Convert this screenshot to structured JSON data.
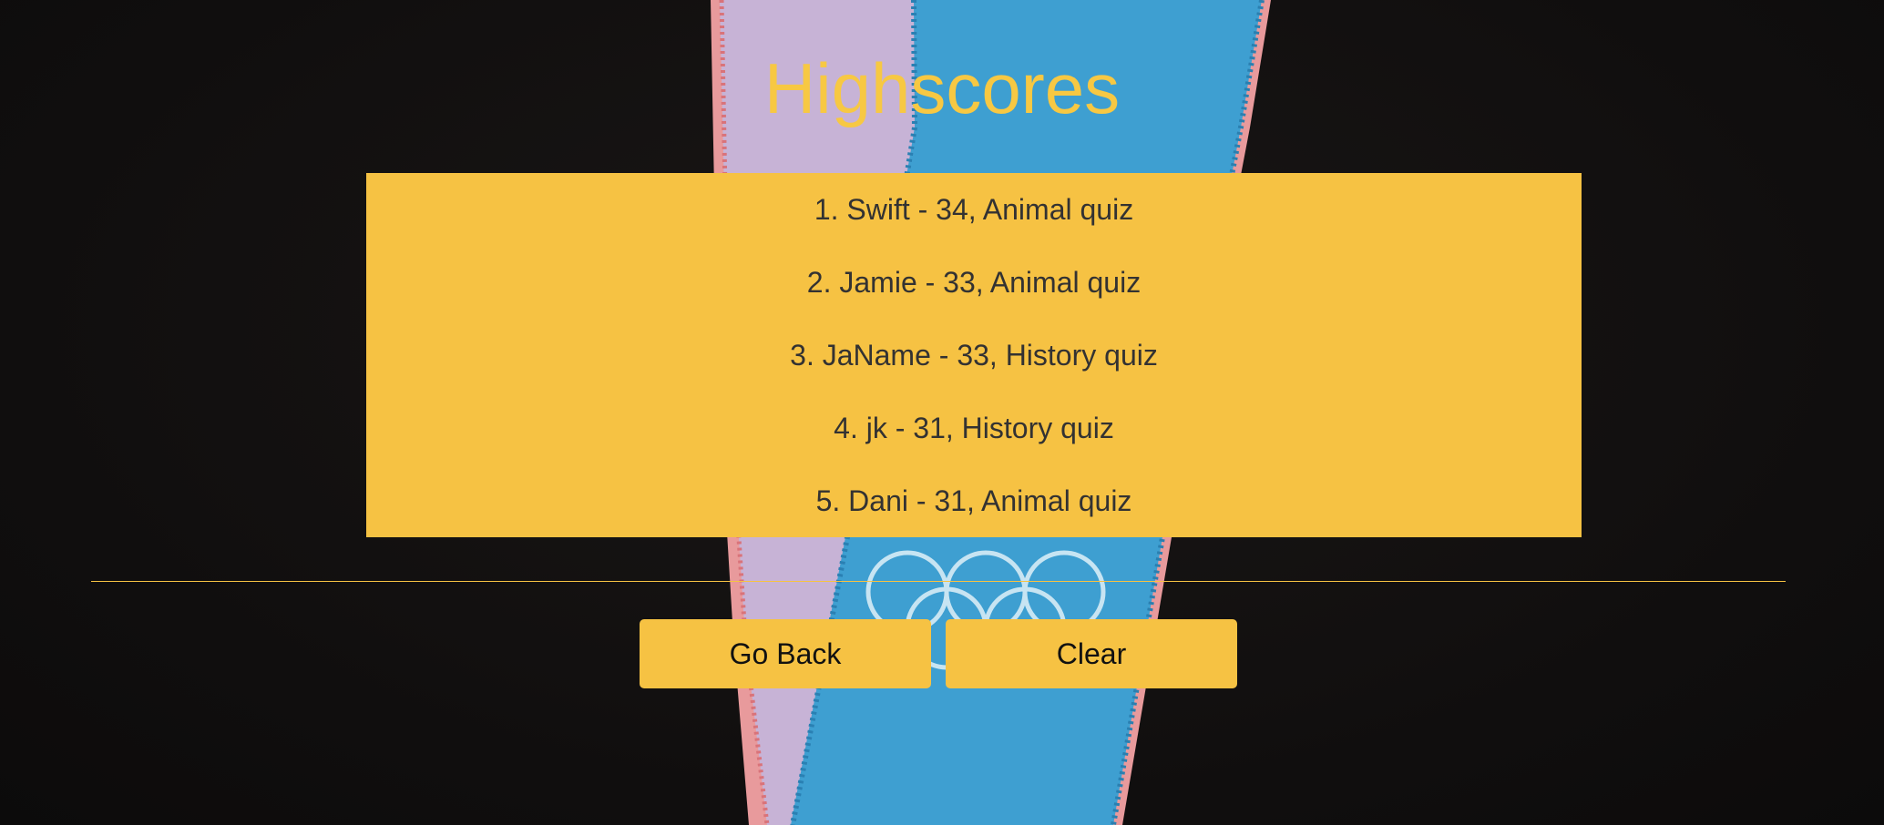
{
  "page": {
    "title": "Highscores"
  },
  "scores": [
    {
      "text": "1. Swift - 34, Animal quiz"
    },
    {
      "text": "2. Jamie - 33, Animal quiz"
    },
    {
      "text": "3. JaName - 33, History quiz"
    },
    {
      "text": "4. jk - 31, History quiz"
    },
    {
      "text": "5. Dani - 31, Animal quiz"
    }
  ],
  "buttons": {
    "go_back_label": "Go Back",
    "clear_label": "Clear"
  },
  "colors": {
    "accent": "#f6c243",
    "title": "#f7c843",
    "background": "#121010",
    "score_text": "#333232",
    "button_text": "#111111"
  },
  "background_image": {
    "icon": "olympic-rings-icon",
    "description_visible": false
  }
}
